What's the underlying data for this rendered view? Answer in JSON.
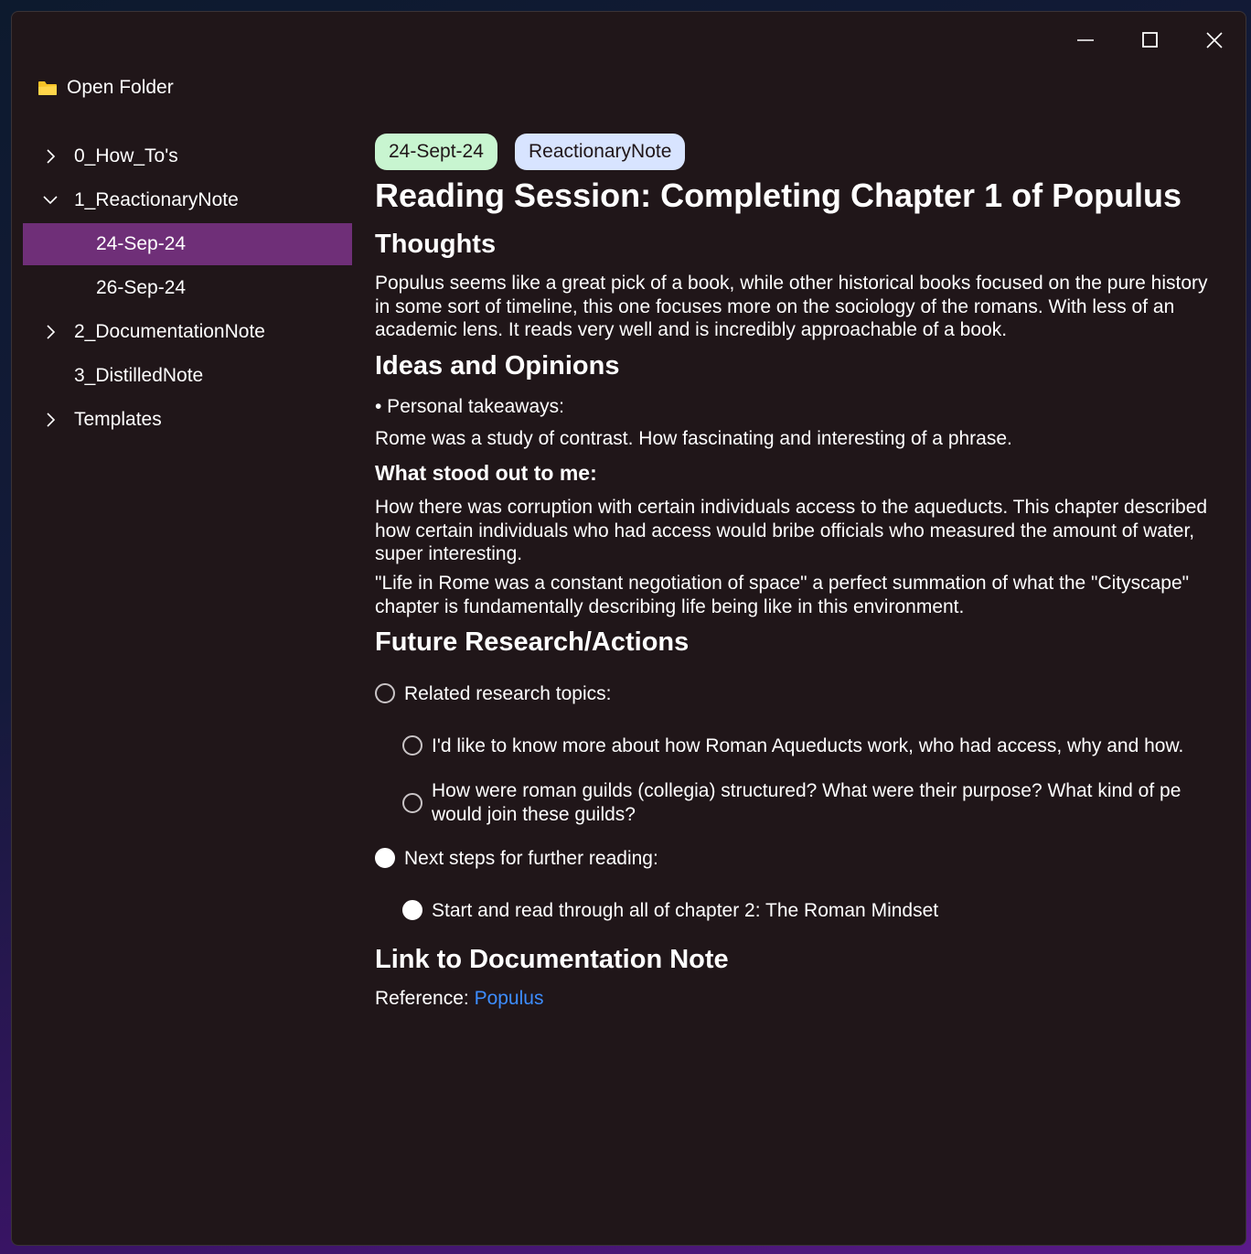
{
  "window": {
    "minimize_icon": "minimize-icon",
    "maximize_icon": "maximize-icon",
    "close_icon": "close-icon"
  },
  "sidebar": {
    "open_folder_label": "Open Folder",
    "folder_icon_color": "#f7c227",
    "selected_color": "#6f2f78",
    "items": [
      {
        "label": "0_How_To's",
        "state": "collapsed"
      },
      {
        "label": "1_ReactionaryNote",
        "state": "expanded"
      },
      {
        "label": "24-Sep-24",
        "state": "selected"
      },
      {
        "label": "26-Sep-24",
        "state": "leaf"
      },
      {
        "label": "2_DocumentationNote",
        "state": "collapsed"
      },
      {
        "label": "3_DistilledNote",
        "state": "leaf"
      },
      {
        "label": "Templates",
        "state": "collapsed"
      }
    ]
  },
  "note": {
    "tags": [
      "24-Sept-24",
      "ReactionaryNote"
    ],
    "title": "Reading Session: Completing Chapter 1 of Populus",
    "thoughts_heading": "Thoughts",
    "thoughts_text": "Populus seems like a great pick of a book, while other historical books focused on the pure history in some sort of timeline, this one focuses more on the sociology of the romans. With less of an academic lens. It reads very well and is incredibly approachable of a book.",
    "ideas_heading": "Ideas and Opinions",
    "bullet": "• Personal takeaways:",
    "takeaway": "Rome was a study of contrast. How fascinating and interesting of a phrase.",
    "stood_out_heading": "What stood out to me:",
    "stood_out_text1": "How there was corruption with certain individuals access to the aqueducts. This chapter described how certain individuals who had access would bribe officials who measured the amount of water, super interesting.",
    "stood_out_text2": "\"Life in Rome was a constant negotiation of space\" a perfect summation of what the \"Cityscape\" chapter is fundamentally describing life being like in this environment.",
    "future_heading": "Future Research/Actions",
    "tasks": [
      {
        "text": "Related research topics:",
        "checked": false
      },
      {
        "text": "I'd like to know more about how Roman Aqueducts work, who had access, why and how.",
        "checked": false
      },
      {
        "text": "How were roman guilds (collegia) structured? What were their purpose? What kind of pe",
        "text2": "would join these guilds?",
        "checked": false
      },
      {
        "text": "Next steps for further reading:",
        "checked": true
      },
      {
        "text": "Start and read through all of chapter 2: The Roman Mindset",
        "checked": true
      }
    ],
    "link_heading": "Link to Documentation Note",
    "reference_label": "Reference: ",
    "reference_link": "Populus",
    "link_color": "#3d8dff"
  }
}
